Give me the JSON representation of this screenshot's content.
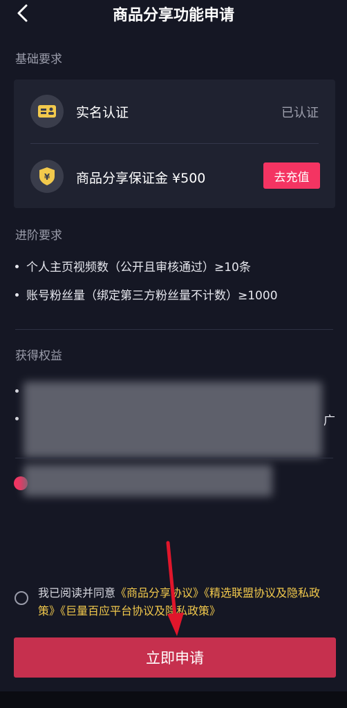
{
  "header": {
    "title": "商品分享功能申请"
  },
  "basic": {
    "section_title": "基础要求",
    "real_name": {
      "label": "实名认证",
      "status": "已认证"
    },
    "deposit": {
      "label": "商品分享保证金 ¥500",
      "button": "去充值"
    }
  },
  "advanced": {
    "section_title": "进阶要求",
    "items": [
      "个人主页视频数（公开且审核通过）≥10条",
      "账号粉丝量（绑定第三方粉丝量不计数）≥1000"
    ]
  },
  "benefits": {
    "section_title": "获得权益",
    "partial_text": "广"
  },
  "agreement": {
    "prefix": "我已阅读并同意",
    "links": [
      "《商品分享协议》",
      "《精选联盟协议及隐私政策》",
      "《巨量百应平台协议及隐私政策》"
    ]
  },
  "apply_button": "立即申请",
  "colors": {
    "accent": "#f43462",
    "link": "#f2c94c",
    "background": "#151724"
  }
}
